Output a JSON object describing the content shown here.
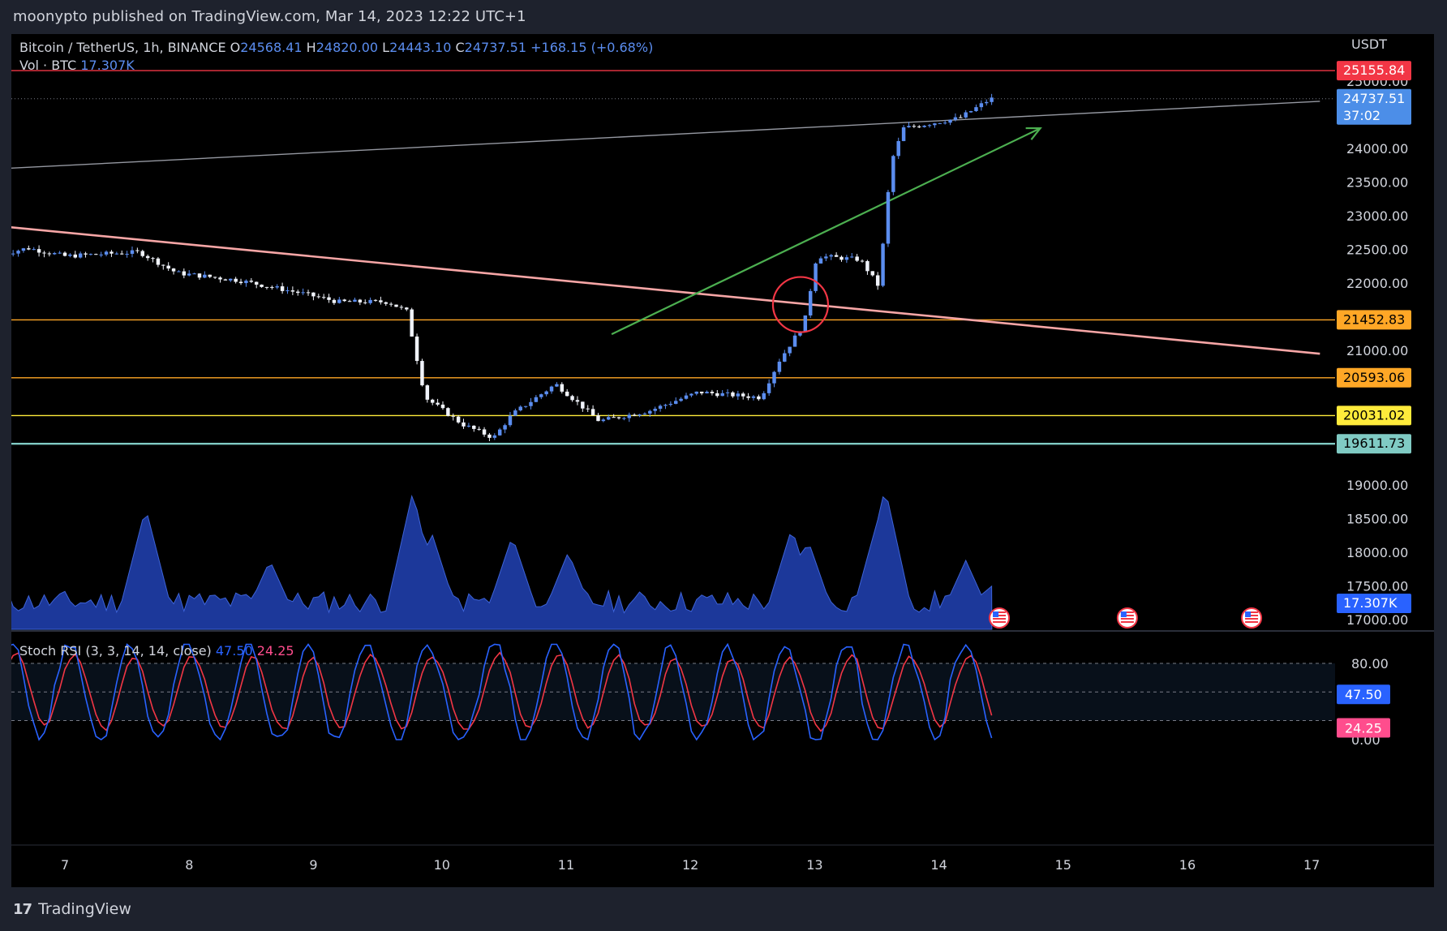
{
  "publish_bar": {
    "text": "moonypto published on TradingView.com, Mar 14, 2023 12:22 UTC+1"
  },
  "header": {
    "symbol": "Bitcoin / TetherUS, 1h, BINANCE",
    "open_label": "O",
    "open": "24568.41",
    "high_label": "H",
    "high": "24820.00",
    "low_label": "L",
    "low": "24443.10",
    "close_label": "C",
    "close": "24737.51",
    "change": "+168.15 (+0.68%)",
    "vol_label": "Vol · BTC",
    "vol_value": "17.307K"
  },
  "price_axis": {
    "unit": "USDT",
    "ticks": [
      "25000.00",
      "24000.00",
      "23500.00",
      "23000.00",
      "22500.00",
      "22000.00",
      "21000.00",
      "20000.00",
      "19000.00",
      "18500.00",
      "18000.00",
      "17500.00",
      "17000.00"
    ]
  },
  "badges": [
    {
      "text": "25155.84",
      "bg": "#f23645",
      "fg": "#ffffff"
    },
    {
      "text": "24737.51",
      "sub": "37:02",
      "bg": "#4c8ee8",
      "fg": "#ffffff"
    },
    {
      "text": "21452.83",
      "bg": "#ffa726",
      "fg": "#000000"
    },
    {
      "text": "20593.06",
      "bg": "#ffa726",
      "fg": "#000000"
    },
    {
      "text": "20031.02",
      "bg": "#ffeb3b",
      "fg": "#000000"
    },
    {
      "text": "19611.73",
      "bg": "#80cbc4",
      "fg": "#000000"
    },
    {
      "text": "17.307K",
      "bg": "#2962ff",
      "fg": "#ffffff"
    }
  ],
  "stoch": {
    "title": "Stoch RSI (3, 3, 14, 14, close)",
    "k_value": "47.50",
    "d_value": "24.25",
    "k_color": "#2962ff",
    "d_color": "#f23645",
    "ticks": [
      "80.00",
      "0.00"
    ],
    "badge_k": "47.50",
    "badge_d": "24.25"
  },
  "time_axis": {
    "labels": [
      "7",
      "8",
      "9",
      "10",
      "11",
      "12",
      "13",
      "14",
      "15",
      "16",
      "17"
    ]
  },
  "footer": {
    "brand": "TradingView"
  },
  "chart_data": {
    "type": "candlestick",
    "title": "Bitcoin / TetherUS, 1h, BINANCE",
    "ohlc_last": {
      "open": 24568.41,
      "high": 24820.0,
      "low": 24443.1,
      "close": 24737.51
    },
    "price_path_anchors": [
      {
        "day": 6.5,
        "price": 22430
      },
      {
        "day": 6.7,
        "price": 22520
      },
      {
        "day": 7.0,
        "price": 22400
      },
      {
        "day": 7.6,
        "price": 22460
      },
      {
        "day": 7.9,
        "price": 22150
      },
      {
        "day": 8.4,
        "price": 22040
      },
      {
        "day": 8.9,
        "price": 21850
      },
      {
        "day": 9.2,
        "price": 21720
      },
      {
        "day": 9.6,
        "price": 21720
      },
      {
        "day": 9.75,
        "price": 21580
      },
      {
        "day": 9.9,
        "price": 20300
      },
      {
        "day": 10.2,
        "price": 19900
      },
      {
        "day": 10.45,
        "price": 19700
      },
      {
        "day": 10.6,
        "price": 20050
      },
      {
        "day": 10.95,
        "price": 20500
      },
      {
        "day": 11.3,
        "price": 19950
      },
      {
        "day": 11.7,
        "price": 20100
      },
      {
        "day": 12.1,
        "price": 20380
      },
      {
        "day": 12.6,
        "price": 20300
      },
      {
        "day": 12.75,
        "price": 20850
      },
      {
        "day": 12.95,
        "price": 21400
      },
      {
        "day": 13.05,
        "price": 22400
      },
      {
        "day": 13.4,
        "price": 22350
      },
      {
        "day": 13.55,
        "price": 21950
      },
      {
        "day": 13.65,
        "price": 23800
      },
      {
        "day": 13.75,
        "price": 24300
      },
      {
        "day": 14.2,
        "price": 24450
      },
      {
        "day": 14.45,
        "price": 24737.51
      }
    ],
    "horizontal_levels": [
      {
        "price": 25155.84,
        "color": "#f23645"
      },
      {
        "price": 21452.83,
        "color": "#ffa726"
      },
      {
        "price": 20593.06,
        "color": "#ffa726"
      },
      {
        "price": 20031.02,
        "color": "#ffeb3b"
      },
      {
        "price": 19611.73,
        "color": "#80cbc4"
      }
    ],
    "trendlines": [
      {
        "color": "#9598a1",
        "from": {
          "day": 6.5,
          "price": 23700
        },
        "to": {
          "day": 17.1,
          "price": 24700
        }
      },
      {
        "color": "#f7a6a6",
        "from": {
          "day": 6.5,
          "price": 22840
        },
        "to": {
          "day": 17.1,
          "price": 20950
        }
      },
      {
        "color": "#4caf50",
        "arrow": true,
        "from": {
          "day": 11.4,
          "price": 21240
        },
        "to": {
          "day": 14.85,
          "price": 24300
        }
      }
    ],
    "marker_circle": {
      "day": 12.92,
      "price": 21680
    },
    "volume_last": "17.307K",
    "stoch_rsi": {
      "k_last": 47.5,
      "d_last": 24.25,
      "upper_band": 80,
      "lower_band": 20
    },
    "xlabel": "",
    "ylabel": "USDT",
    "ylim": [
      16800,
      25350
    ],
    "xlim_days": [
      6.5,
      17.1
    ]
  }
}
